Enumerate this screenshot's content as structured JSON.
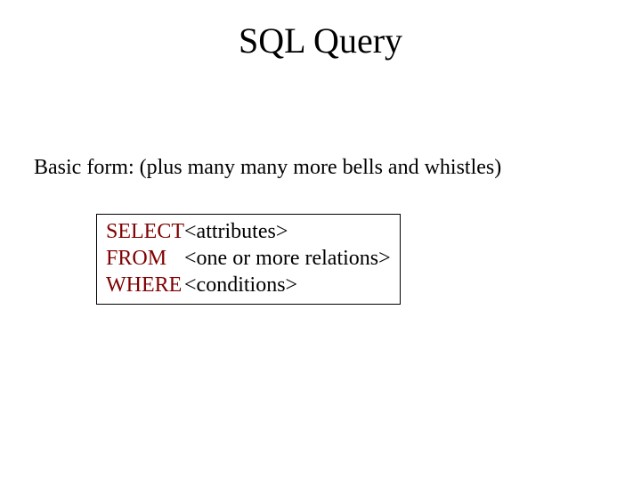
{
  "title": "SQL Query",
  "subhead": "Basic form: (plus many many more bells and whistles)",
  "code": {
    "rows": [
      {
        "keyword": "SELECT",
        "arg": "<attributes>"
      },
      {
        "keyword": "FROM",
        "arg": "<one or more relations>"
      },
      {
        "keyword": "WHERE",
        "arg": "<conditions>"
      }
    ]
  }
}
